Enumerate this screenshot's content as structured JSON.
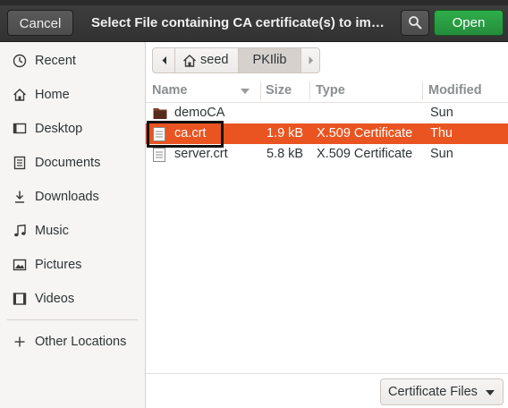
{
  "header": {
    "cancel_label": "Cancel",
    "title": "Select File containing CA certificate(s) to im…",
    "open_label": "Open",
    "search_icon": "search-icon"
  },
  "sidebar": {
    "items": [
      {
        "label": "Recent",
        "icon": "clock-icon"
      },
      {
        "label": "Home",
        "icon": "home-icon"
      },
      {
        "label": "Desktop",
        "icon": "desktop-icon"
      },
      {
        "label": "Documents",
        "icon": "document-icon"
      },
      {
        "label": "Downloads",
        "icon": "download-icon"
      },
      {
        "label": "Music",
        "icon": "music-icon"
      },
      {
        "label": "Pictures",
        "icon": "picture-icon"
      },
      {
        "label": "Videos",
        "icon": "video-icon"
      },
      {
        "label": "Other Locations",
        "icon": "plus-icon"
      }
    ]
  },
  "pathbar": {
    "segments": [
      "seed",
      "PKIlib"
    ]
  },
  "columns": {
    "name": "Name",
    "size": "Size",
    "type": "Type",
    "modified": "Modified"
  },
  "files": [
    {
      "name": "demoCA",
      "size": "",
      "type": "",
      "modified": "Sun",
      "kind": "folder"
    },
    {
      "name": "ca.crt",
      "size": "1.9 kB",
      "type": "X.509 Certificate",
      "modified": "Thu",
      "kind": "file",
      "selected": true
    },
    {
      "name": "server.crt",
      "size": "5.8 kB",
      "type": "X.509 Certificate",
      "modified": "Sun",
      "kind": "file"
    }
  ],
  "filter": {
    "selected": "Certificate Files"
  },
  "colors": {
    "accent": "#e95420",
    "open_button": "#26a042",
    "header_bg": "#373737"
  }
}
